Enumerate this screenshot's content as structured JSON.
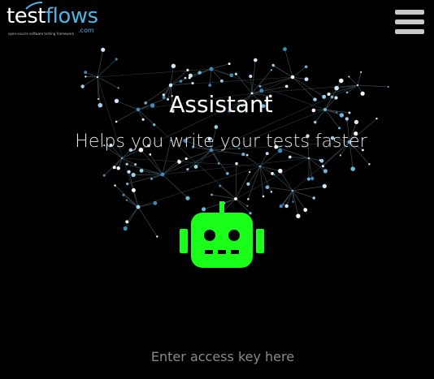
{
  "brand": {
    "word_part1": "test",
    "word_part2": "flows",
    "suffix": ".com",
    "tagline": "open-source software testing framework",
    "accent_color": "#4fb3e6"
  },
  "header": {
    "menu_icon": "hamburger-menu-icon"
  },
  "hero": {
    "title": "Assistant",
    "subtitle": "Helps you write your tests faster",
    "background_graphic": "network-graph",
    "robot_icon": "robot-icon",
    "robot_color": "#1aff1a"
  },
  "access": {
    "placeholder": "Enter access key here",
    "value": ""
  }
}
